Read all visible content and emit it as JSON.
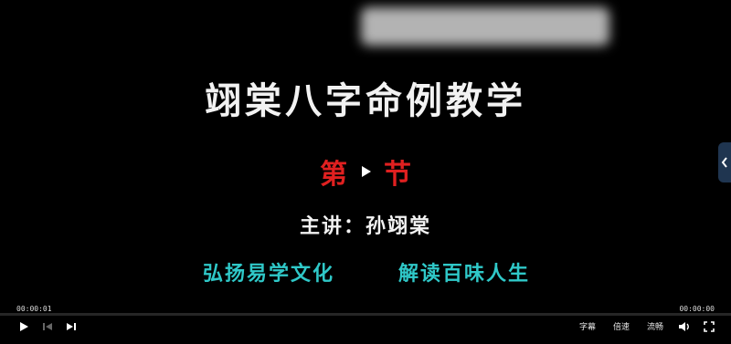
{
  "slide": {
    "title": "翊棠八字命例教学",
    "section_left": "第",
    "section_right": "节",
    "lecturer": "主讲：孙翊棠",
    "slogan_left": "弘扬易学文化",
    "slogan_right": "解读百味人生"
  },
  "player": {
    "current_time": "00:00:01",
    "duration": "00:00:00",
    "progress": 0,
    "subtitle_label": "字幕",
    "speed_label": "倍速",
    "quality_label": "流畅"
  },
  "colors": {
    "background": "#000000",
    "title": "#f2f2f2",
    "section": "#e02020",
    "slogan": "#2fc8c8",
    "handle": "#1f3550"
  },
  "icons": [
    "play-icon",
    "previous-icon",
    "next-icon",
    "volume-icon",
    "fullscreen-icon",
    "chevron-left-icon",
    "center-play-icon"
  ]
}
